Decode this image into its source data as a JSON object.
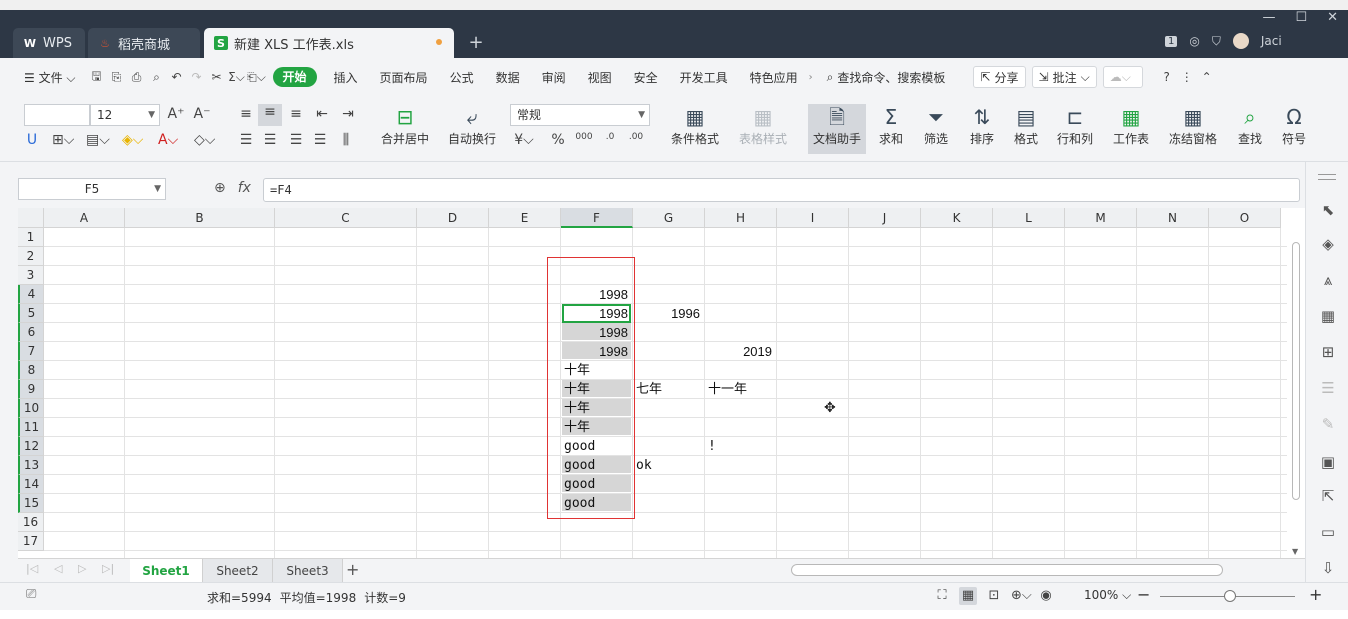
{
  "tabs": [
    {
      "label": "WPS",
      "icon": "W",
      "color": "#2b6bd8"
    },
    {
      "label": "稻壳商城",
      "icon": "稻",
      "color": "#e8542d"
    },
    {
      "label": "新建 XLS 工作表.xls",
      "icon": "S",
      "color": "#22a442"
    }
  ],
  "window": {
    "user": "Jaci",
    "badge": "1"
  },
  "menu": {
    "file": "文件",
    "items": [
      "开始",
      "插入",
      "页面布局",
      "公式",
      "数据",
      "审阅",
      "视图",
      "安全",
      "开发工具",
      "特色应用"
    ],
    "search": "查找命令、搜索模板",
    "share": "分享",
    "comment": "批注"
  },
  "toolbar": {
    "font_name": "",
    "font_size": "12",
    "number_format": "常规",
    "merge_center": "合并居中",
    "wrap_text": "自动换行",
    "cond_format": "条件格式",
    "table_style": "表格样式",
    "doc_assist": "文档助手",
    "sum": "求和",
    "filter": "筛选",
    "sort": "排序",
    "format": "格式",
    "row_col": "行和列",
    "worksheet": "工作表",
    "freeze": "冻结窗格",
    "find": "查找",
    "symbol": "符号"
  },
  "formula_bar": {
    "name_box": "F5",
    "fx": "fx",
    "formula": "=F4"
  },
  "grid": {
    "columns": [
      "A",
      "B",
      "C",
      "D",
      "E",
      "F",
      "G",
      "H",
      "I",
      "J",
      "K",
      "L",
      "M",
      "N",
      "O"
    ],
    "rows": [
      "1",
      "2",
      "3",
      "4",
      "5",
      "6",
      "7",
      "8",
      "9",
      "10",
      "11",
      "12",
      "13",
      "14",
      "15",
      "16",
      "17"
    ],
    "cells": {
      "F4": "1998",
      "F5": "1998",
      "F6": "1998",
      "F7": "1998",
      "G5": "1996",
      "H7": "2019",
      "F8": "十年",
      "F9": "十年",
      "F10": "十年",
      "F11": "十年",
      "G9": "七年",
      "H9": "十一年",
      "F12": "good",
      "F13": "good",
      "F14": "good",
      "F15": "good",
      "G13": "ok",
      "H12": "!"
    }
  },
  "sheets": [
    "Sheet1",
    "Sheet2",
    "Sheet3"
  ],
  "status": {
    "sum": "求和=5994",
    "avg": "平均值=1998",
    "count": "计数=9",
    "zoom": "100%"
  }
}
